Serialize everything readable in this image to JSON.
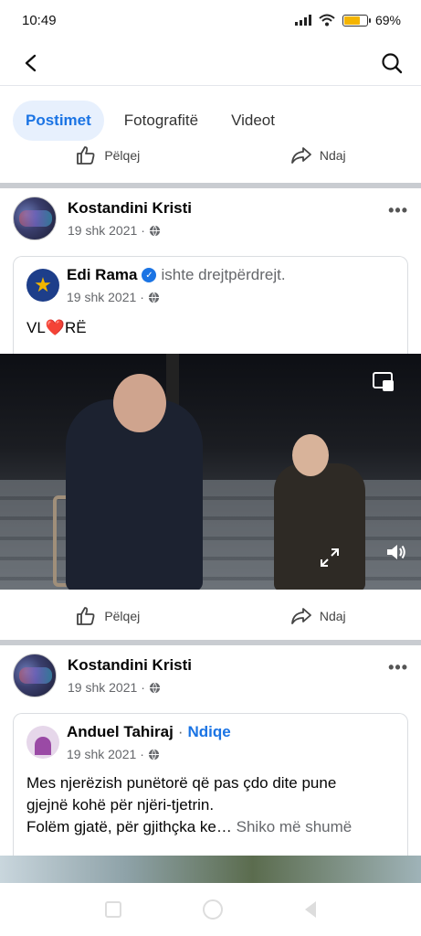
{
  "status_bar": {
    "time": "10:49",
    "battery": "69%",
    "battery_level": 0.69
  },
  "tabs": [
    {
      "label": "Postimet",
      "active": true
    },
    {
      "label": "Fotografitë",
      "active": false
    },
    {
      "label": "Videot",
      "active": false
    }
  ],
  "actions": {
    "like_label": "Pëlqej",
    "share_label": "Ndaj"
  },
  "posts": [
    {
      "author": "Kostandini Kristi",
      "date": "19 shk 2021",
      "shared": {
        "author": "Edi Rama",
        "status": "ishte drejtpërdrejt.",
        "date": "19 shk 2021",
        "text_before": "VL",
        "text_heart": "❤️",
        "text_after": "RË"
      }
    },
    {
      "author": "Kostandini Kristi",
      "date": "19 shk 2021",
      "shared": {
        "author": "Anduel Tahiraj",
        "follow": "Ndiqe",
        "date": "19 shk 2021",
        "text_line1": "Mes njerëzish punëtorë që pas çdo dite pune",
        "text_line2": "gjejnë kohë për njëri-tjetrin.",
        "text_line3": "Folëm gjatë, për gjithçka ke…",
        "see_more": "Shiko më shumë"
      }
    }
  ],
  "colors": {
    "accent": "#1b74e4",
    "tab_active_bg": "#e7f0fd",
    "secondary_text": "#65676b",
    "separator": "#c9ccd1"
  },
  "icons": [
    "back-arrow-icon",
    "search-icon",
    "like-icon",
    "share-icon",
    "globe-icon",
    "more-icon",
    "verified-icon",
    "pip-icon",
    "expand-icon",
    "volume-icon"
  ]
}
